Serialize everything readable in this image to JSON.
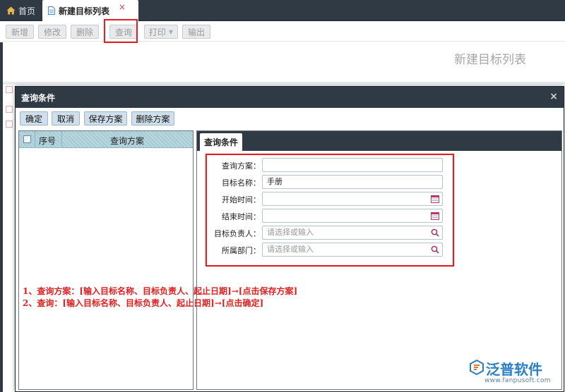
{
  "tabs": {
    "home_label": "首页",
    "active_label": "新建目标列表",
    "close_glyph": "×"
  },
  "toolbar": {
    "new_label": "新增",
    "edit_label": "修改",
    "delete_label": "删除",
    "query_label": "查询",
    "print_label": "打印",
    "export_label": "输出"
  },
  "page_title": "新建目标列表",
  "dialog": {
    "title": "查询条件",
    "close_glyph": "×",
    "buttons": {
      "ok": "确定",
      "cancel": "取消",
      "save_plan": "保存方案",
      "delete_plan": "删除方案"
    },
    "plan_list": {
      "columns": {
        "no": "序号",
        "plan": "查询方案"
      }
    },
    "condition_tab": "查询条件",
    "fields": {
      "plan": {
        "label": "查询方案：",
        "value": ""
      },
      "name": {
        "label": "目标名称：",
        "value": "手册"
      },
      "start": {
        "label": "开始时间：",
        "value": ""
      },
      "end": {
        "label": "结束时间：",
        "value": ""
      },
      "owner": {
        "label": "目标负责人：",
        "placeholder": "请选择或输入"
      },
      "dept": {
        "label": "所属部门：",
        "placeholder": "请选择或输入"
      }
    }
  },
  "annotations": {
    "line1": "1、查询方案：[输入目标名称、目标负责人、起止日期]→[点击保存方案]",
    "line2": "2、查询：[输入目标名称、目标负责人、起止日期]→[点击确定]"
  },
  "logo": {
    "name": "泛普软件",
    "url": "www.fanpusoft.com"
  },
  "colors": {
    "dark_header": "#2f3a44",
    "highlight_red": "#e02020",
    "button_blue": "#cfe0ec",
    "logo_blue": "#2a7fc8"
  },
  "icons": {
    "home": "home-icon",
    "document": "document-icon",
    "calendar": "calendar-icon",
    "search": "search-icon"
  }
}
